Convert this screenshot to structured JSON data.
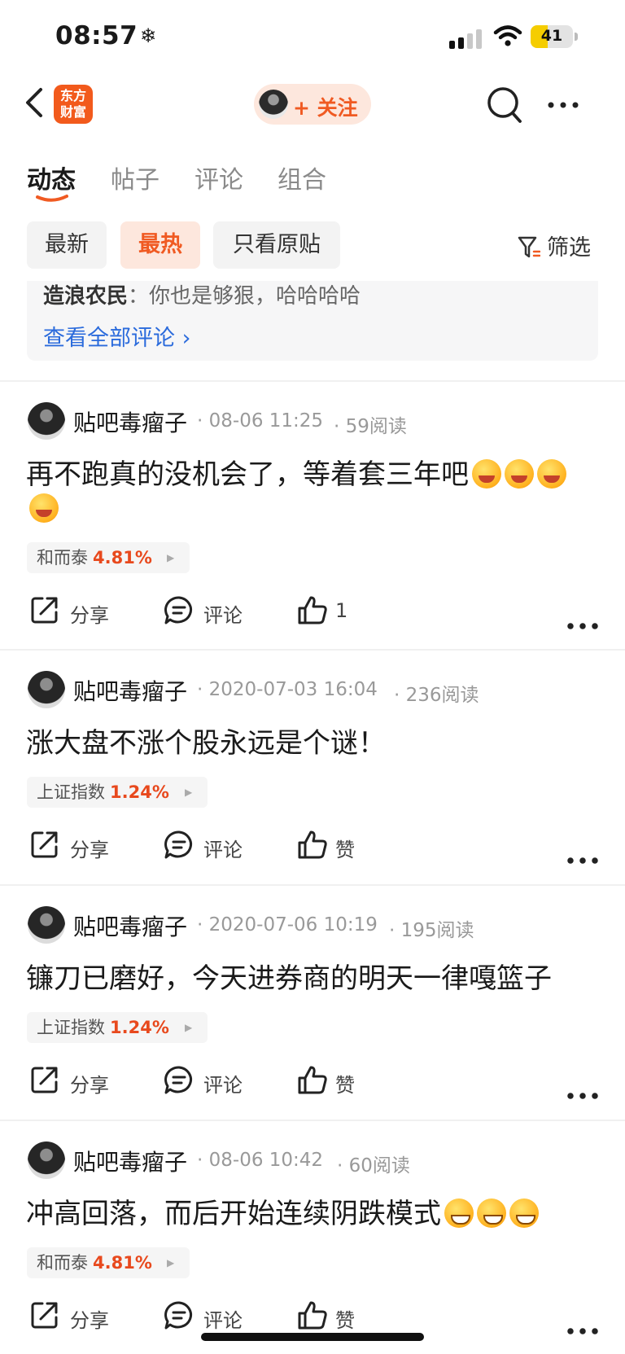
{
  "status_bar": {
    "time": "08:57",
    "snow_icon": "❄",
    "battery_level": "41",
    "battery_fraction": 0.41
  },
  "header": {
    "logo_text_1": "东方",
    "logo_text_2": "财富",
    "follow_label": "+ 关注"
  },
  "tabs": [
    "动态",
    "帖子",
    "评论",
    "组合"
  ],
  "filters": {
    "chips": [
      "最新",
      "最热",
      "只看原贴"
    ],
    "active": "最热",
    "filter_label": "筛选"
  },
  "comment_preview": {
    "commenter": "造浪农民",
    "text": "：你也是够狠，哈哈哈哈",
    "view_all": "查看全部评论 ›"
  },
  "posts": [
    {
      "author": "贴吧毒瘤子",
      "date": "· 08-06 11:25",
      "reads": "· 59阅读",
      "text": "再不跑真的没机会了，等着套三年吧",
      "emojis": [
        "face-with-hand-over-mouth",
        "face-with-hand-over-mouth",
        "zany-face",
        "zany-face"
      ],
      "stock_name": "和而泰",
      "stock_pct": "4.81%",
      "share": "分享",
      "comment": "评论",
      "like": "1"
    },
    {
      "author": "贴吧毒瘤子",
      "date": "· 2020-07-03 16:04",
      "reads": "· 236阅读",
      "text": "涨大盘不涨个股永远是个谜！",
      "stock_name": "上证指数",
      "stock_pct": "1.24%",
      "share": "分享",
      "comment": "评论",
      "like": "赞"
    },
    {
      "author": "贴吧毒瘤子",
      "date": "· 2020-07-06 10:19",
      "reads": "· 195阅读",
      "text": "镰刀已磨好，今天进券商的明天一律嘎篮子",
      "stock_name": "上证指数",
      "stock_pct": "1.24%",
      "share": "分享",
      "comment": "评论",
      "like": "赞"
    },
    {
      "author": "贴吧毒瘤子",
      "date": "· 08-06 10:42",
      "reads": "· 60阅读",
      "text": "冲高回落，而后开始连续阴跌模式",
      "emojis": [
        "grinning-face",
        "grinning-face",
        "grinning-face"
      ],
      "stock_name": "和而泰",
      "stock_pct": "4.81%",
      "share": "分享",
      "comment": "评论",
      "like": "赞"
    }
  ],
  "icons": {
    "back": "chevron-left-icon",
    "search": "search-icon",
    "more": "more-horizontal-icon",
    "share": "share-icon",
    "comment": "comment-icon",
    "like": "thumbs-up-icon",
    "filter": "filter-icon"
  },
  "colors": {
    "accent": "#f05a22",
    "link": "#2b6bdc",
    "stock_up": "#e8491d",
    "logo": "#f25a1c"
  }
}
